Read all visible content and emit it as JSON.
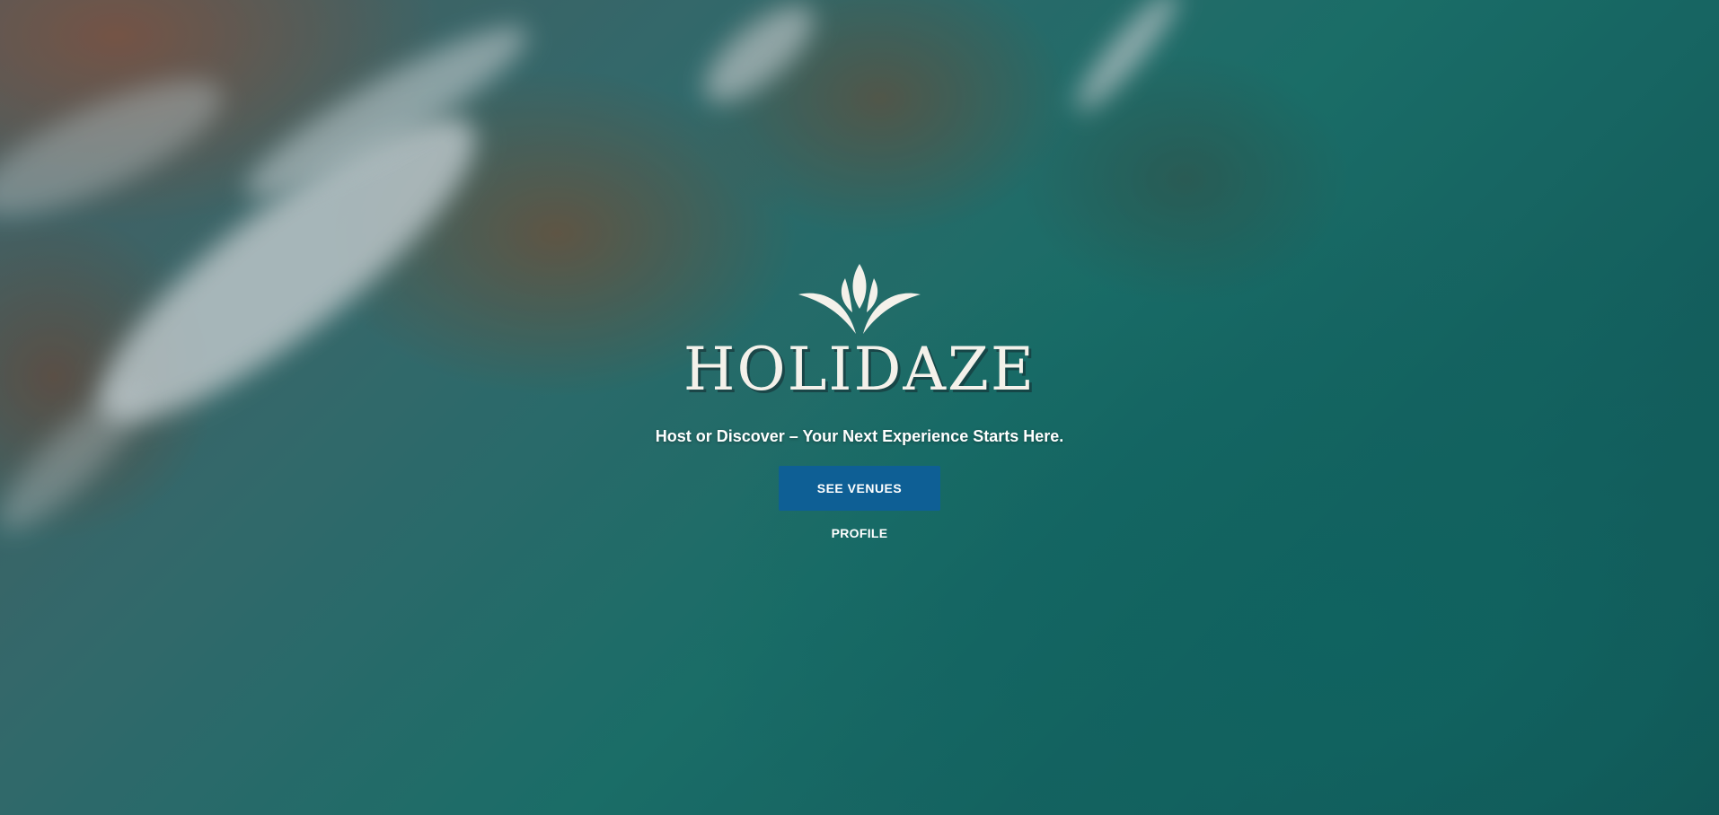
{
  "brand": {
    "name": "HOLIDAZE",
    "logo_icon": "lotus-leaf-icon"
  },
  "hero": {
    "tagline": "Host or Discover – Your Next Experience Starts Here.",
    "background": "aerial-ocean-coastline-image"
  },
  "actions": {
    "see_venues_label": "SEE VENUES",
    "profile_label": "PROFILE"
  },
  "colors": {
    "primary_button": "#0e5f95",
    "text": "#ffffff",
    "logo": "#f4f1ea"
  }
}
